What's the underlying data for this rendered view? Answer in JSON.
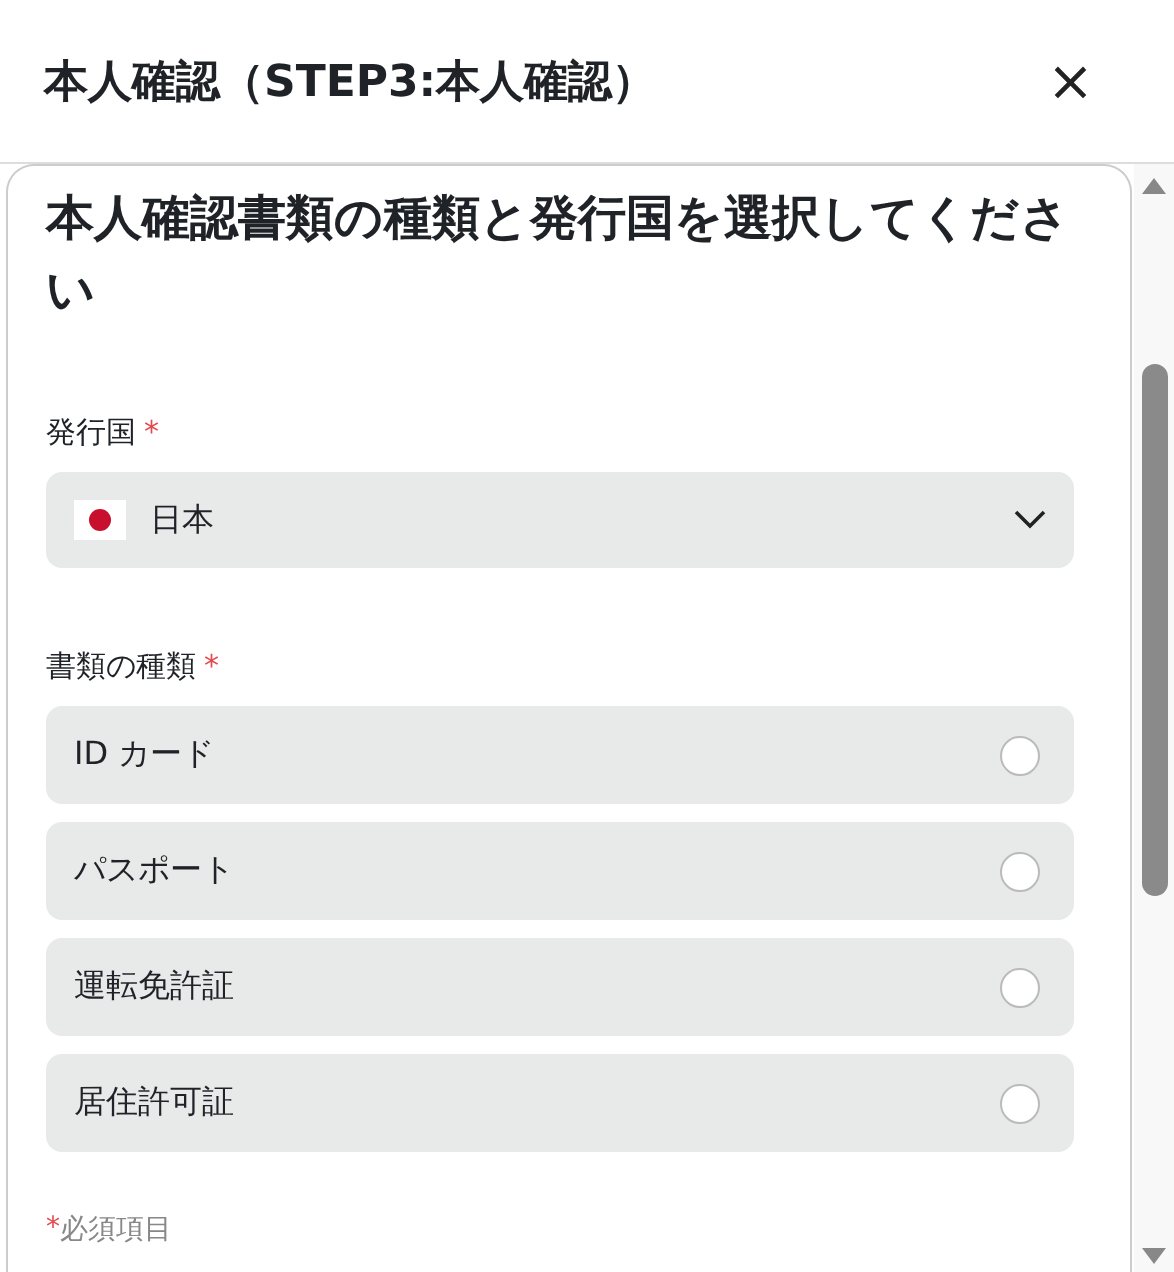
{
  "dialog": {
    "title": "本人確認（STEP3:本人確認）",
    "close": "×"
  },
  "heading": "本人確認書類の種類と発行国を選択してください",
  "country": {
    "label": "発行国",
    "required_mark": "*",
    "value": "日本"
  },
  "document_type": {
    "label": "書類の種類",
    "required_mark": "*",
    "options": [
      {
        "label": "ID カード",
        "selected": false
      },
      {
        "label": "パスポート",
        "selected": false
      },
      {
        "label": "運転免許証",
        "selected": false
      },
      {
        "label": "居住許可証",
        "selected": false
      }
    ]
  },
  "footnote": {
    "mark": "*",
    "text": "必須項目"
  }
}
